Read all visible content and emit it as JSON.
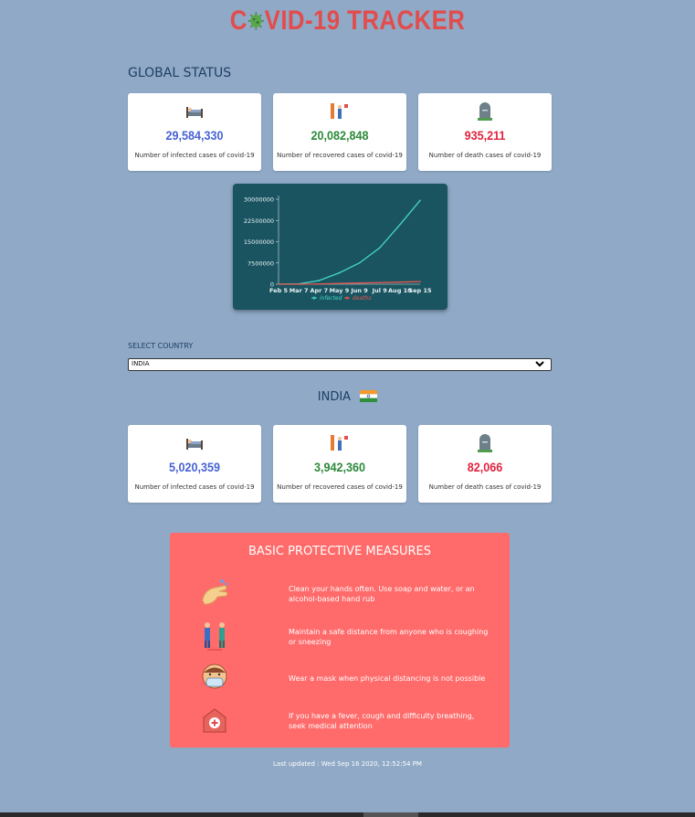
{
  "title": {
    "prefix": "C",
    "suffix": "VID-19 TRACKER"
  },
  "global": {
    "label": "GLOBAL STATUS",
    "cards": [
      {
        "icon": "hospital-bed-icon",
        "value": "29,584,330",
        "desc": "Number of infected cases of covid-19",
        "color": "#4763d4"
      },
      {
        "icon": "recovered-people-icon",
        "value": "20,082,848",
        "desc": "Number of recovered cases of covid-19",
        "color": "#2d8a3a"
      },
      {
        "icon": "gravestone-icon",
        "value": "935,211",
        "desc": "Number of death cases of covid-19",
        "color": "#e0243f"
      }
    ]
  },
  "chart_data": {
    "type": "line",
    "x": [
      "Feb 5",
      "Mar 7",
      "Apr 7",
      "May 9",
      "Jun 9",
      "Jul 9",
      "Aug 10",
      "Sep 15"
    ],
    "series": [
      {
        "name": "infected",
        "color": "#46d6c8",
        "values": [
          30000,
          100000,
          1300000,
          4000000,
          7500000,
          12800000,
          21000000,
          29584330
        ]
      },
      {
        "name": "deaths",
        "color": "#e8554e",
        "values": [
          600,
          3500,
          80000,
          280000,
          420000,
          560000,
          740000,
          935211
        ]
      }
    ],
    "yticks": [
      "0",
      "7500000",
      "15000000",
      "22500000",
      "30000000"
    ],
    "ylim": [
      0,
      30000000
    ],
    "legend": "bottom-center",
    "grid": false
  },
  "select": {
    "label": "SELECT COUNTRY",
    "value": "INDIA"
  },
  "country": {
    "name": "INDIA",
    "cards": [
      {
        "icon": "hospital-bed-icon",
        "value": "5,020,359",
        "desc": "Number of infected cases of covid-19",
        "color": "#4763d4"
      },
      {
        "icon": "recovered-people-icon",
        "value": "3,942,360",
        "desc": "Number of recovered cases of covid-19",
        "color": "#2d8a3a"
      },
      {
        "icon": "gravestone-icon",
        "value": "82,066",
        "desc": "Number of death cases of covid-19",
        "color": "#e0243f"
      }
    ]
  },
  "measures": {
    "title": "BASIC PROTECTIVE MEASURES",
    "items": [
      {
        "icon": "washing-hands-icon",
        "text": "Clean your hands often. Use soap and water, or an alcohol-based hand rub"
      },
      {
        "icon": "social-distance-icon",
        "text": "Maintain a safe distance from anyone who is coughing or sneezing"
      },
      {
        "icon": "face-mask-icon",
        "text": "Wear a mask when physical distancing is not possible"
      },
      {
        "icon": "hospital-icon",
        "text": "If you have a fever, cough and difficulty breathing, seek medical attention"
      }
    ]
  },
  "updated": "Last updated : Wed Sep 16 2020, 12:52:54 PM"
}
